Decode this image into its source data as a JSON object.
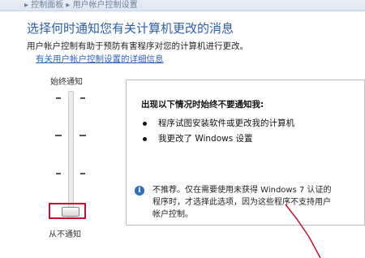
{
  "window": {
    "breadcrumb": "▸ 控制面板 ▸ 用户帐户控制设置"
  },
  "header": {
    "title": "选择何时通知您有关计算机更改的消息",
    "description": "用户帐户控制有助于预防有害程序对您的计算机进行更改。",
    "help_link": "有关用户帐户控制设置的详细信息"
  },
  "slider": {
    "top_label": "始终通知",
    "bottom_label": "从不通知",
    "level": 0,
    "levels": 4
  },
  "info_panel": {
    "title": "出现以下情况时始终不要通知我:",
    "items": [
      "程序试图安装软件或更改我的计算机",
      "我更改了 Windows 设置"
    ],
    "note": "不推荐。仅在需要使用未获得 Windows 7 认证的程序时，才选择此选项，因为这些程序不支持用户帐户控制。"
  },
  "colors": {
    "heading": "#2a5ea9",
    "link": "#2f64b0",
    "highlight": "#c8102e",
    "info_icon": "#2f6fc0"
  }
}
